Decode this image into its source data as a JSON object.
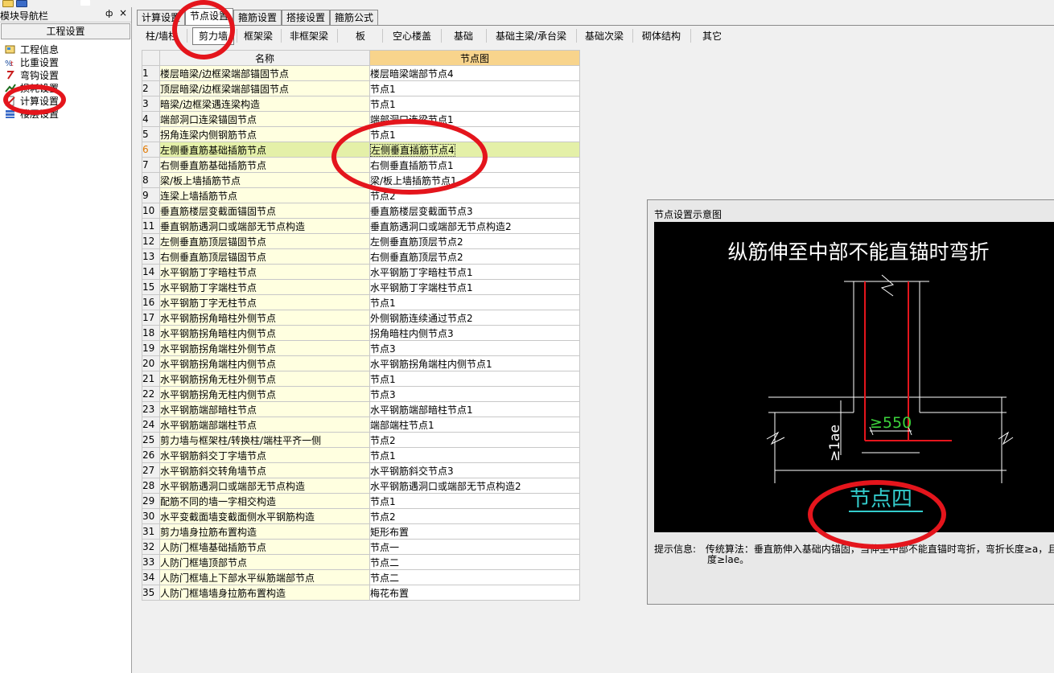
{
  "nav": {
    "title": "模块导航栏",
    "pin_glyph": "ф",
    "close_glyph": "×",
    "group": "工程设置",
    "items": [
      {
        "label": "工程信息",
        "icon": "project-info-icon"
      },
      {
        "label": "比重设置",
        "icon": "weight-settings-icon"
      },
      {
        "label": "弯钩设置",
        "icon": "hook-settings-icon"
      },
      {
        "label": "损耗设置",
        "icon": "loss-settings-icon"
      },
      {
        "label": "计算设置",
        "icon": "calc-settings-icon"
      },
      {
        "label": "楼层设置",
        "icon": "floor-settings-icon"
      }
    ]
  },
  "tabs": [
    "计算设置",
    "节点设置",
    "箍筋设置",
    "搭接设置",
    "箍筋公式"
  ],
  "active_tab": "节点设置",
  "subtabs": [
    "柱/墙柱",
    "剪力墙",
    "框架梁",
    "非框架梁",
    "板",
    "空心楼盖",
    "基础",
    "基础主梁/承台梁",
    "基础次梁",
    "砌体结构",
    "其它"
  ],
  "active_subtab": "剪力墙",
  "grid": {
    "col_name": "名称",
    "col_diagram": "节点图",
    "selected_row": 6,
    "rows": [
      {
        "no": "1",
        "name": "楼层暗梁/边框梁端部锚固节点",
        "value": "楼层暗梁端部节点4"
      },
      {
        "no": "2",
        "name": "顶层暗梁/边框梁端部锚固节点",
        "value": "节点1"
      },
      {
        "no": "3",
        "name": "暗梁/边框梁遇连梁构造",
        "value": "节点1"
      },
      {
        "no": "4",
        "name": "端部洞口连梁锚固节点",
        "value": "端部洞口连梁节点1"
      },
      {
        "no": "5",
        "name": "拐角连梁内侧钢筋节点",
        "value": "节点1"
      },
      {
        "no": "6",
        "name": "左侧垂直筋基础插筋节点",
        "value": "左侧垂直插筋节点4"
      },
      {
        "no": "7",
        "name": "右侧垂直筋基础插筋节点",
        "value": "右侧垂直插筋节点1"
      },
      {
        "no": "8",
        "name": "梁/板上墙插筋节点",
        "value": "梁/板上墙插筋节点1"
      },
      {
        "no": "9",
        "name": "连梁上墙插筋节点",
        "value": "节点2"
      },
      {
        "no": "10",
        "name": "垂直筋楼层变截面锚固节点",
        "value": "垂直筋楼层变截面节点3"
      },
      {
        "no": "11",
        "name": "垂直钢筋遇洞口或端部无节点构造",
        "value": "垂直筋遇洞口或端部无节点构造2"
      },
      {
        "no": "12",
        "name": "左侧垂直筋顶层锚固节点",
        "value": "左侧垂直筋顶层节点2"
      },
      {
        "no": "13",
        "name": "右侧垂直筋顶层锚固节点",
        "value": "右侧垂直筋顶层节点2"
      },
      {
        "no": "14",
        "name": "水平钢筋丁字暗柱节点",
        "value": "水平钢筋丁字暗柱节点1"
      },
      {
        "no": "15",
        "name": "水平钢筋丁字端柱节点",
        "value": "水平钢筋丁字端柱节点1"
      },
      {
        "no": "16",
        "name": "水平钢筋丁字无柱节点",
        "value": "节点1"
      },
      {
        "no": "17",
        "name": "水平钢筋拐角暗柱外侧节点",
        "value": "外侧钢筋连续通过节点2"
      },
      {
        "no": "18",
        "name": "水平钢筋拐角暗柱内侧节点",
        "value": "拐角暗柱内侧节点3"
      },
      {
        "no": "19",
        "name": "水平钢筋拐角端柱外侧节点",
        "value": "节点3"
      },
      {
        "no": "20",
        "name": "水平钢筋拐角端柱内侧节点",
        "value": "水平钢筋拐角端柱内侧节点1"
      },
      {
        "no": "21",
        "name": "水平钢筋拐角无柱外侧节点",
        "value": "节点1"
      },
      {
        "no": "22",
        "name": "水平钢筋拐角无柱内侧节点",
        "value": "节点3"
      },
      {
        "no": "23",
        "name": "水平钢筋端部暗柱节点",
        "value": "水平钢筋端部暗柱节点1"
      },
      {
        "no": "24",
        "name": "水平钢筋端部端柱节点",
        "value": "端部端柱节点1"
      },
      {
        "no": "25",
        "name": "剪力墙与框架柱/转换柱/端柱平齐一侧",
        "value": "节点2"
      },
      {
        "no": "26",
        "name": "水平钢筋斜交丁字墙节点",
        "value": "节点1"
      },
      {
        "no": "27",
        "name": "水平钢筋斜交转角墙节点",
        "value": "水平钢筋斜交节点3"
      },
      {
        "no": "28",
        "name": "水平钢筋遇洞口或端部无节点构造",
        "value": "水平钢筋遇洞口或端部无节点构造2"
      },
      {
        "no": "29",
        "name": "配筋不同的墙一字相交构造",
        "value": "节点1"
      },
      {
        "no": "30",
        "name": "水平变截面墙变截面侧水平钢筋构造",
        "value": "节点2"
      },
      {
        "no": "31",
        "name": "剪力墙身拉筋布置构造",
        "value": "矩形布置"
      },
      {
        "no": "32",
        "name": "人防门框墙基础插筋节点",
        "value": "节点一"
      },
      {
        "no": "33",
        "name": "人防门框墙顶部节点",
        "value": "节点二"
      },
      {
        "no": "34",
        "name": "人防门框墙上下部水平纵筋端部节点",
        "value": "节点二"
      },
      {
        "no": "35",
        "name": "人防门框墙墙身拉筋布置构造",
        "value": "梅花布置"
      }
    ]
  },
  "diagram": {
    "window_title": "节点设置示意图",
    "heading": "纵筋伸至中部不能直锚时弯折",
    "dim_label": "≥550",
    "lae_label": "≥1ae",
    "node_label": "节点四",
    "hint_label": "提示信息:",
    "hint_line1": "传统算法：垂直筋伸入基础内锚固，当伸至中部不能直锚时弯折，弯折长度≥a，且",
    "hint_line2": "度≥lae。"
  },
  "colors": {
    "selected_row": "#e4f0a8",
    "name_cell": "#ffffe0",
    "header_highlight": "#f8d48c",
    "annotation": "#e4151c",
    "rebar": "#e4151c",
    "dimension": "#3cd33c",
    "node_label": "#33cccc"
  }
}
